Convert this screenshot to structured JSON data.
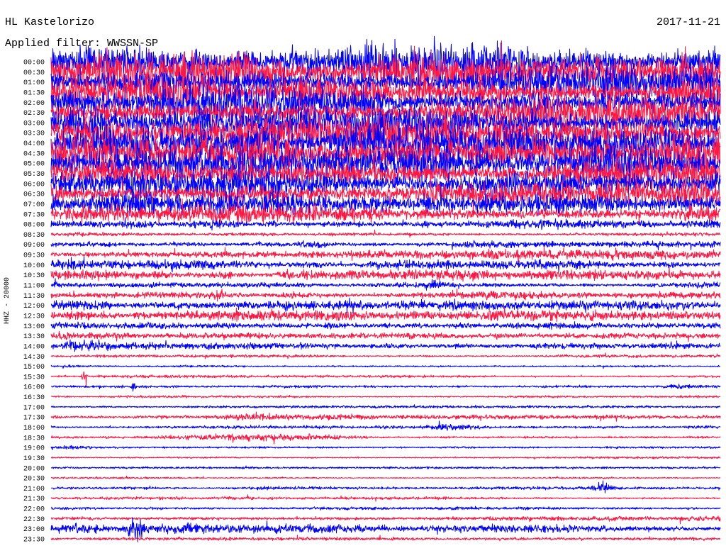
{
  "chart_data": {
    "type": "line",
    "title": "HL Kastelorizo",
    "date": "2017-11-21",
    "filter": "Applied filter: WWSSN-SP",
    "ylabel": "HHZ - 20000",
    "row_minutes": 30,
    "colors": {
      "hour": "#0000ff",
      "half": "#ff1744"
    },
    "rows": [
      {
        "label": "00:00",
        "amplitude": 1.8,
        "bursts": [
          [
            17.4,
            0.15,
            3.0
          ]
        ]
      },
      {
        "label": "00:30",
        "amplitude": 1.8
      },
      {
        "label": "01:00",
        "amplitude": 1.8
      },
      {
        "label": "01:30",
        "amplitude": 1.7
      },
      {
        "label": "02:00",
        "amplitude": 1.8
      },
      {
        "label": "02:30",
        "amplitude": 1.7
      },
      {
        "label": "03:00",
        "amplitude": 1.6
      },
      {
        "label": "03:30",
        "amplitude": 1.7
      },
      {
        "label": "04:00",
        "amplitude": 1.6
      },
      {
        "label": "04:30",
        "amplitude": 1.7
      },
      {
        "label": "05:00",
        "amplitude": 1.6
      },
      {
        "label": "05:30",
        "amplitude": 1.5
      },
      {
        "label": "06:00",
        "amplitude": 1.5
      },
      {
        "label": "06:30",
        "amplitude": 1.4
      },
      {
        "label": "07:00",
        "amplitude": 1.3
      },
      {
        "label": "07:30",
        "amplitude": 0.9
      },
      {
        "label": "08:00",
        "amplitude": 0.45,
        "bursts": [
          [
            2.5,
            1.5,
            0.6
          ],
          [
            7,
            1.5,
            0.6
          ]
        ]
      },
      {
        "label": "08:30",
        "amplitude": 0.22
      },
      {
        "label": "09:00",
        "amplitude": 0.35,
        "bursts": [
          [
            11.5,
            1,
            0.6
          ]
        ]
      },
      {
        "label": "09:30",
        "amplitude": 0.3,
        "bursts": [
          [
            22,
            8,
            0.9
          ]
        ]
      },
      {
        "label": "10:00",
        "amplitude": 0.45,
        "bursts": [
          [
            0.5,
            0.8,
            0.8
          ]
        ]
      },
      {
        "label": "10:30",
        "amplitude": 0.5,
        "bursts": [
          [
            2.5,
            2,
            0.8
          ],
          [
            7.8,
            0.4,
            1.0
          ]
        ]
      },
      {
        "label": "11:00",
        "amplitude": 0.28,
        "bursts": [
          [
            17.2,
            0.5,
            1.0
          ]
        ]
      },
      {
        "label": "11:30",
        "amplitude": 0.32,
        "bursts": [
          [
            21,
            4,
            0.6
          ],
          [
            7.6,
            0.3,
            1.2
          ]
        ]
      },
      {
        "label": "12:00",
        "amplitude": 0.45,
        "bursts": [
          [
            1.5,
            1.5,
            0.6
          ]
        ]
      },
      {
        "label": "12:30",
        "amplitude": 0.5
      },
      {
        "label": "13:00",
        "amplitude": 0.5
      },
      {
        "label": "13:30",
        "amplitude": 0.5
      },
      {
        "label": "14:00",
        "amplitude": 0.35,
        "bursts": [
          [
            1.5,
            1,
            0.6
          ]
        ]
      },
      {
        "label": "14:30",
        "amplitude": 0.14
      },
      {
        "label": "15:00",
        "amplitude": 0.14
      },
      {
        "label": "15:30",
        "amplitude": 0.14,
        "bursts": [
          [
            1.5,
            0.1,
            5.0
          ]
        ]
      },
      {
        "label": "16:00",
        "amplitude": 0.14,
        "bursts": [
          [
            3.7,
            0.1,
            4.0
          ],
          [
            28,
            0.5,
            0.8
          ]
        ]
      },
      {
        "label": "16:30",
        "amplitude": 0.12
      },
      {
        "label": "17:00",
        "amplitude": 0.12
      },
      {
        "label": "17:30",
        "amplitude": 0.2,
        "bursts": [
          [
            5,
            1,
            1.2
          ],
          [
            9,
            2,
            1.5
          ],
          [
            13,
            1,
            1.0
          ]
        ]
      },
      {
        "label": "18:00",
        "amplitude": 0.15,
        "bursts": [
          [
            18,
            1,
            1.5
          ]
        ]
      },
      {
        "label": "18:30",
        "amplitude": 0.2,
        "bursts": [
          [
            7,
            2,
            1.2
          ],
          [
            11,
            2,
            1.0
          ]
        ]
      },
      {
        "label": "19:00",
        "amplitude": 0.15,
        "bursts": [
          [
            1,
            0.5,
            1.0
          ]
        ]
      },
      {
        "label": "19:30",
        "amplitude": 0.1
      },
      {
        "label": "20:00",
        "amplitude": 0.1
      },
      {
        "label": "20:30",
        "amplitude": 0.1
      },
      {
        "label": "21:00",
        "amplitude": 0.15,
        "bursts": [
          [
            24.7,
            0.4,
            2.5
          ]
        ]
      },
      {
        "label": "21:30",
        "amplitude": 0.15
      },
      {
        "label": "22:00",
        "amplitude": 0.15
      },
      {
        "label": "22:30",
        "amplitude": 0.2,
        "bursts": [
          [
            27,
            8,
            1.5
          ]
        ]
      },
      {
        "label": "23:00",
        "amplitude": 0.38,
        "bursts": [
          [
            0.5,
            1.5,
            1.0
          ],
          [
            3.8,
            0.4,
            2.5
          ],
          [
            6,
            2,
            0.3
          ]
        ]
      },
      {
        "label": "23:30",
        "amplitude": 0.15
      }
    ]
  }
}
